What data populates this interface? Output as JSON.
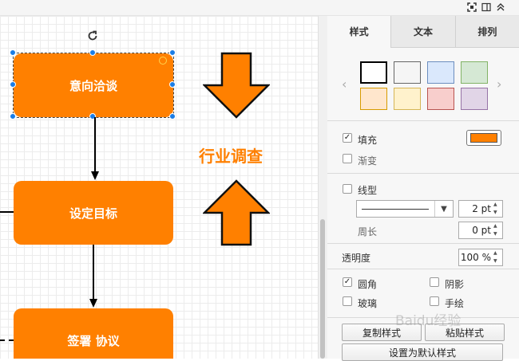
{
  "topbar": {
    "icons": [
      "fit-page-icon",
      "format-panel-icon",
      "collapse-icon"
    ]
  },
  "canvas": {
    "nodes": [
      {
        "id": "n1",
        "label": "意向洽谈",
        "selected": true
      },
      {
        "id": "n2",
        "label": "设定目标"
      },
      {
        "id": "n3",
        "label": "签署 协议"
      }
    ],
    "float_text": "行业调查",
    "fill_color": "#ff8000"
  },
  "panel": {
    "tabs": [
      {
        "label": "样式",
        "active": true
      },
      {
        "label": "文本",
        "active": false
      },
      {
        "label": "排列",
        "active": false
      }
    ],
    "swatches": [
      {
        "fill": "#ffffff",
        "stroke": "#000000"
      },
      {
        "fill": "#f5f5f5",
        "stroke": "#666666"
      },
      {
        "fill": "#dae8fc",
        "stroke": "#6c8ebf"
      },
      {
        "fill": "#d5e8d4",
        "stroke": "#82b366"
      },
      {
        "fill": "#ffe6cc",
        "stroke": "#d79b00"
      },
      {
        "fill": "#fff2cc",
        "stroke": "#d6b656"
      },
      {
        "fill": "#f8cecc",
        "stroke": "#b85450"
      },
      {
        "fill": "#e1d5e7",
        "stroke": "#9673a6"
      }
    ],
    "fill": {
      "label": "填充",
      "checked": true,
      "color": "#ff8000"
    },
    "gradient": {
      "label": "渐变",
      "checked": false
    },
    "line": {
      "label": "线型",
      "checked": false,
      "width": "2 pt"
    },
    "perimeter": {
      "label": "周长",
      "value": "0 pt"
    },
    "opacity": {
      "label": "透明度",
      "value": "100 %"
    },
    "options": {
      "rounded": {
        "label": "圆角",
        "checked": true
      },
      "shadow": {
        "label": "阴影",
        "checked": false
      },
      "glass": {
        "label": "玻璃",
        "checked": false
      },
      "sketch": {
        "label": "手绘",
        "checked": false
      }
    },
    "buttons": {
      "copy_style": "复制样式",
      "paste_style": "粘贴样式",
      "set_default": "设置为默认样式"
    }
  },
  "watermark": "Baidu经验"
}
